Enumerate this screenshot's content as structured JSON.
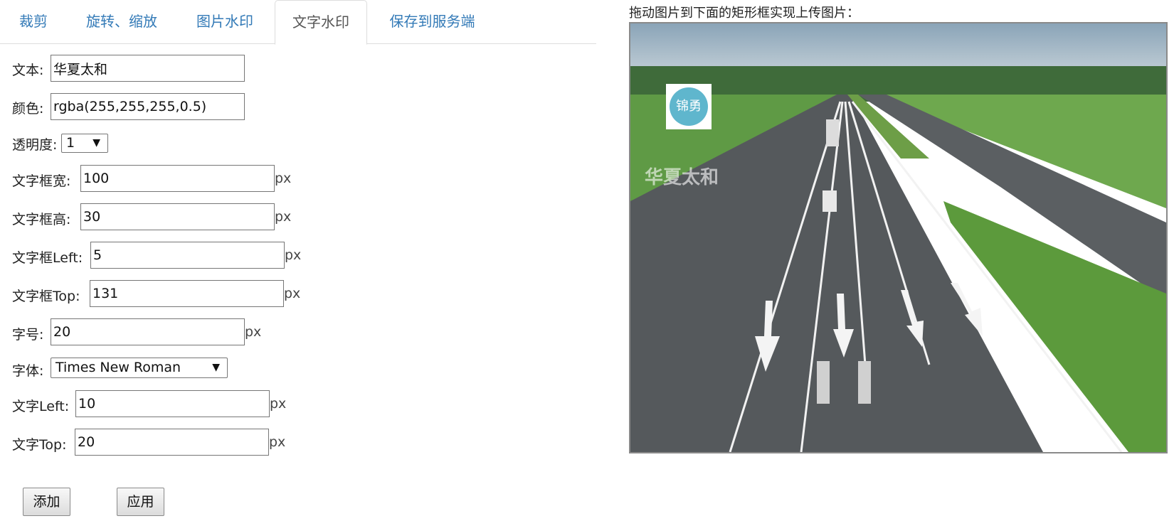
{
  "tabs": [
    {
      "label": "裁剪",
      "active": false
    },
    {
      "label": "旋转、缩放",
      "active": false
    },
    {
      "label": "图片水印",
      "active": false
    },
    {
      "label": "文字水印",
      "active": true
    },
    {
      "label": "保存到服务端",
      "active": false
    }
  ],
  "form": {
    "text": {
      "label": "文本:",
      "value": "华夏太和"
    },
    "color": {
      "label": "颜色:",
      "value": "rgba(255,255,255,0.5)"
    },
    "opacity": {
      "label": "透明度:",
      "value": "1"
    },
    "box_width": {
      "label": "文字框宽:",
      "value": "100",
      "unit": "px"
    },
    "box_height": {
      "label": "文字框高:",
      "value": "30",
      "unit": "px"
    },
    "box_left": {
      "label": "文字框Left:",
      "value": "5",
      "unit": "px"
    },
    "box_top": {
      "label": "文字框Top:",
      "value": "131",
      "unit": "px"
    },
    "font_size": {
      "label": "字号:",
      "value": "20",
      "unit": "px"
    },
    "font_family": {
      "label": "字体:",
      "value": "Times New Roman"
    },
    "text_left": {
      "label": "文字Left:",
      "value": "10",
      "unit": "px"
    },
    "text_top": {
      "label": "文字Top:",
      "value": "20",
      "unit": "px"
    }
  },
  "buttons": {
    "add": "添加",
    "apply": "应用"
  },
  "upload": {
    "hint": "拖动图片到下面的矩形框实现上传图片：",
    "logo_text": "锦勇",
    "watermark_text": "华夏太和"
  },
  "icons": {
    "dropdown": "chevron-down-icon"
  }
}
